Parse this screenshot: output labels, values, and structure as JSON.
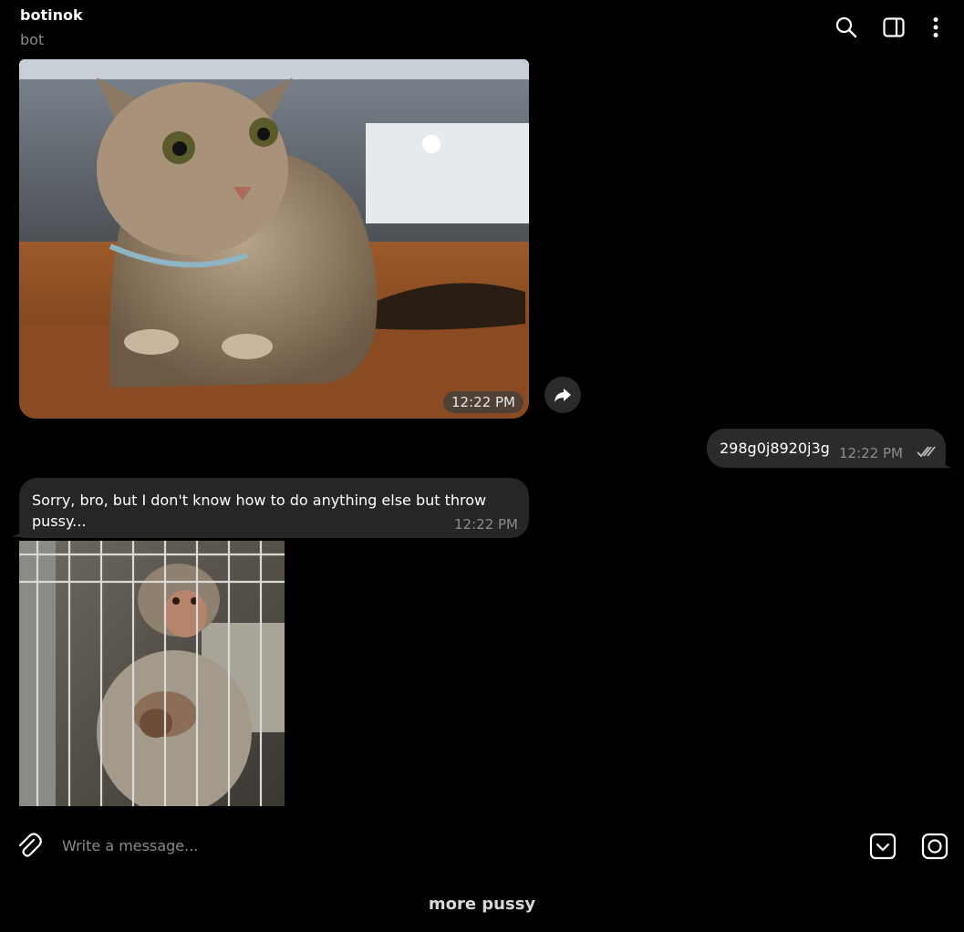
{
  "header": {
    "title": "botinok",
    "subtitle": "bot",
    "icons": [
      "search-icon",
      "sidebar-toggle-icon",
      "more-vertical-icon"
    ]
  },
  "messages": {
    "cat_photo": {
      "time": "12:22 PM"
    },
    "outgoing": {
      "text": "298g0j8920j3g",
      "time": "12:22 PM"
    },
    "reply": {
      "text": "Sorry, bro, but I don't know how to do anything else but throw pussy...",
      "time": "12:22 PM"
    }
  },
  "composer": {
    "placeholder": "Write a message...",
    "icons": [
      "paperclip-icon",
      "bot-keyboard-icon",
      "camera-icon"
    ]
  },
  "keyboard": {
    "button_label": "more pussy"
  }
}
